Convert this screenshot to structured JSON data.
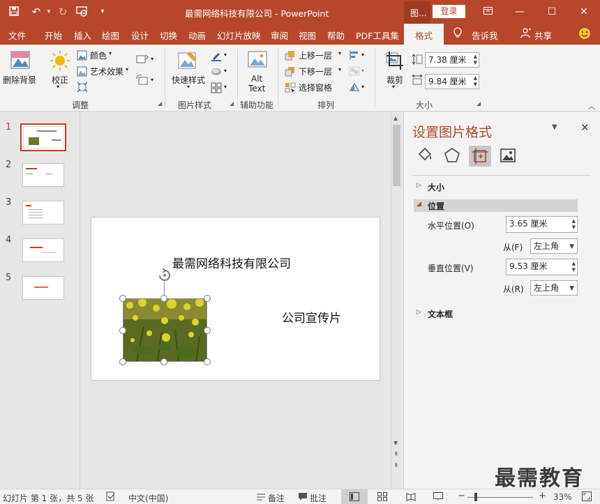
{
  "window": {
    "title": "最需网络科技有限公司  -  PowerPoint",
    "contextual_tab": "图...",
    "login_label": "登录"
  },
  "tabs": {
    "items": [
      "文件",
      "开始",
      "插入",
      "绘图",
      "设计",
      "切换",
      "动画",
      "幻灯片放映",
      "审阅",
      "视图",
      "帮助",
      "PDF工具集",
      "格式"
    ],
    "tell_me": "告诉我",
    "share": "共享"
  },
  "ribbon": {
    "adjust": {
      "remove_bg": "删除背景",
      "correct": "校正",
      "color": "颜色",
      "art_effects": "艺术效果",
      "group_label": "调整"
    },
    "styles": {
      "quick_styles": "快速样式",
      "group_label": "图片样式"
    },
    "access": {
      "alt_text_1": "Alt",
      "alt_text_2": "Text",
      "group_label": "辅助功能"
    },
    "arrange": {
      "bring_forward": "上移一层",
      "send_backward": "下移一层",
      "selection_pane": "选择窗格",
      "group_label": "排列"
    },
    "size": {
      "crop": "裁剪",
      "height": "7.38 厘米",
      "width": "9.84 厘米",
      "group_label": "大小"
    }
  },
  "thumbnails": {
    "numbers": [
      "1",
      "2",
      "3",
      "4",
      "5"
    ],
    "selected": "1"
  },
  "slide": {
    "title": "最需网络科技有限公司",
    "subtitle": "公司宣传片"
  },
  "format_pane": {
    "title": "设置图片格式",
    "section_size": "大小",
    "section_position": "位置",
    "horizontal_label": "水平位置(O)",
    "horizontal_value": "3.65 厘米",
    "from_label_1": "从(F)",
    "from_value_1": "左上角",
    "vertical_label": "垂直位置(V)",
    "vertical_value": "9.53 厘米",
    "from_label_2": "从(R)",
    "from_value_2": "左上角",
    "section_textbox": "文本框"
  },
  "status": {
    "slide_info": "幻灯片 第 1 张，共 5 张",
    "language": "中文(中国)",
    "notes": "备注",
    "comments": "批注",
    "zoom": "33%"
  },
  "watermark": "最需教育",
  "colors": {
    "brand": "#b7472a",
    "selection": "#c43e1c"
  }
}
